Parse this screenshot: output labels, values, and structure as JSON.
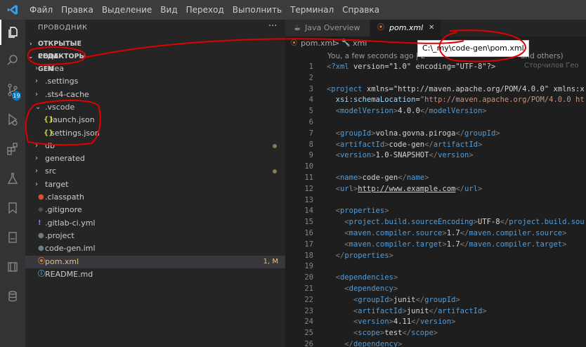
{
  "menubar": {
    "logo_icon": "vscode-logo-icon",
    "items": [
      "Файл",
      "Правка",
      "Выделение",
      "Вид",
      "Переход",
      "Выполнить",
      "Терминал",
      "Справка"
    ]
  },
  "activity_bar": {
    "items": [
      "explorer-icon",
      "search-icon",
      "source-control-icon",
      "run-debug-icon",
      "extensions-icon",
      "testing-icon",
      "bookmarks-icon",
      "book-icon",
      "docker-icon",
      "database-icon"
    ],
    "scm_badge": "19"
  },
  "sidebar": {
    "title": "ПРОВОДНИК",
    "more": "···",
    "open_editors": "ОТКРЫТЫЕ РЕДАКТОРЫ",
    "folder": "CODE-GEN",
    "tree": [
      {
        "name": ".idea",
        "type": "folder"
      },
      {
        "name": ".settings",
        "type": "folder"
      },
      {
        "name": ".sts4-cache",
        "type": "folder"
      },
      {
        "name": ".vscode",
        "type": "folder-open"
      },
      {
        "name": "launch.json",
        "type": "json"
      },
      {
        "name": "settings.json",
        "type": "json"
      },
      {
        "name": "db",
        "type": "folder"
      },
      {
        "name": "generated",
        "type": "folder"
      },
      {
        "name": "src",
        "type": "folder"
      },
      {
        "name": "target",
        "type": "folder"
      },
      {
        "name": ".classpath",
        "type": "file"
      },
      {
        "name": ".gitignore",
        "type": "file"
      },
      {
        "name": ".gitlab-ci.yml",
        "type": "yml"
      },
      {
        "name": ".project",
        "type": "file"
      },
      {
        "name": "code-gen.iml",
        "type": "file"
      },
      {
        "name": "pom.xml",
        "type": "xml",
        "status": "1, M"
      },
      {
        "name": "README.md",
        "type": "md"
      }
    ]
  },
  "editor": {
    "tabs": [
      {
        "label": "Java Overview",
        "icon": "java-overview-icon"
      },
      {
        "label": "pom.xml",
        "icon": "rss-xml-icon",
        "close": "✕"
      }
    ],
    "breadcrumbs": [
      "pom.xml",
      ">",
      "xml"
    ],
    "blame": "You, a few seconds ago | 2",
    "blame_tail": "and others)",
    "tooltip": "C:\\_my\\code-gen\\pom.xml",
    "ghost_text": "Сторчилов Гео",
    "lines": [
      {
        "n": "1",
        "text": "<?xml version=\"1.0\" encoding=\"UTF-8\"?>"
      },
      {
        "n": "2",
        "text": ""
      },
      {
        "n": "3",
        "text": "<project xmlns=\"http://maven.apache.org/POM/4.0.0\" xmlns:x"
      },
      {
        "n": "4",
        "text": "  xsi:schemaLocation=\"http://maven.apache.org/POM/4.0.0 ht"
      },
      {
        "n": "5",
        "text": "  <modelVersion>4.0.0</modelVersion>"
      },
      {
        "n": "6",
        "text": ""
      },
      {
        "n": "7",
        "text": "  <groupId>volna.govna.piroga</groupId>"
      },
      {
        "n": "8",
        "text": "  <artifactId>code-gen</artifactId>"
      },
      {
        "n": "9",
        "text": "  <version>1.0-SNAPSHOT</version>"
      },
      {
        "n": "10",
        "text": ""
      },
      {
        "n": "11",
        "text": "  <name>code-gen</name>"
      },
      {
        "n": "12",
        "text": "  <url>http://www.example.com</url>"
      },
      {
        "n": "13",
        "text": ""
      },
      {
        "n": "14",
        "text": "  <properties>"
      },
      {
        "n": "15",
        "text": "    <project.build.sourceEncoding>UTF-8</project.build.sou"
      },
      {
        "n": "16",
        "text": "    <maven.compiler.source>1.7</maven.compiler.source>"
      },
      {
        "n": "17",
        "text": "    <maven.compiler.target>1.7</maven.compiler.target>"
      },
      {
        "n": "18",
        "text": "  </properties>"
      },
      {
        "n": "19",
        "text": ""
      },
      {
        "n": "20",
        "text": "  <dependencies>"
      },
      {
        "n": "21",
        "text": "    <dependency>"
      },
      {
        "n": "22",
        "text": "      <groupId>junit</groupId>"
      },
      {
        "n": "23",
        "text": "      <artifactId>junit</artifactId>"
      },
      {
        "n": "24",
        "text": "      <version>4.11</version>"
      },
      {
        "n": "25",
        "text": "      <scope>test</scope>"
      },
      {
        "n": "26",
        "text": "    </dependency>"
      }
    ]
  },
  "colors": {
    "accent": "#007acc",
    "annotation": "#e00000",
    "modified": "#e2c08d"
  }
}
